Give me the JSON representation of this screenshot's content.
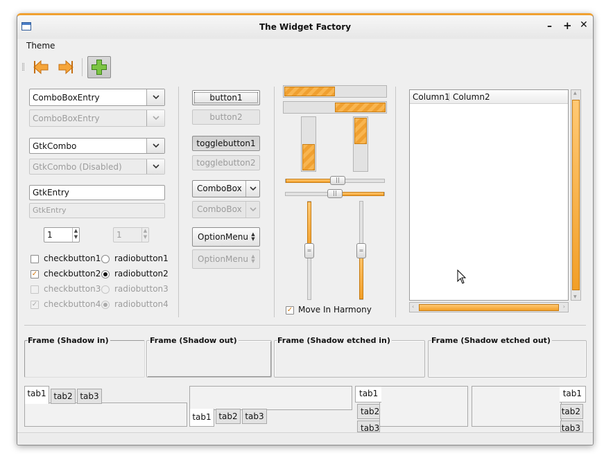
{
  "window": {
    "title": "The Widget Factory"
  },
  "menu": {
    "theme": "Theme"
  },
  "col1": {
    "combo_entry": "ComboBoxEntry",
    "combo_entry_disabled": "ComboBoxEntry",
    "gtk_combo": "GtkCombo",
    "gtk_combo_disabled": "GtkCombo (Disabled)",
    "entry": "GtkEntry",
    "entry_disabled": "GtkEntry",
    "spin1": "1",
    "spin2": "1",
    "check1": "checkbutton1",
    "check2": "checkbutton2",
    "check3": "checkbutton3",
    "check4": "checkbutton4",
    "radio1": "radiobutton1",
    "radio2": "radiobutton2",
    "radio3": "radiobutton3",
    "radio4": "radiobutton4"
  },
  "col2": {
    "button1": "button1",
    "button2": "button2",
    "toggle1": "togglebutton1",
    "toggle2": "togglebutton2",
    "combobox": "ComboBox",
    "combobox_disabled": "ComboBox",
    "option": "OptionMenu",
    "option_disabled": "OptionMenu"
  },
  "col3": {
    "progress_h1": 0.5,
    "progress_h2": 0.5,
    "progress_v1": 0.5,
    "progress_v2": 0.5,
    "harmony_label": "Move In Harmony"
  },
  "tree": {
    "column1": "Column1",
    "column2": "Column2"
  },
  "frames": {
    "shadow_in": "Frame (Shadow in)",
    "shadow_out": "Frame (Shadow out)",
    "etched_in": "Frame (Shadow etched in)",
    "etched_out": "Frame (Shadow etched out)"
  },
  "tabs": {
    "t1": "tab1",
    "t2": "tab2",
    "t3": "tab3"
  },
  "colors": {
    "accent": "#f0a030",
    "accent_dark": "#c97f16"
  }
}
